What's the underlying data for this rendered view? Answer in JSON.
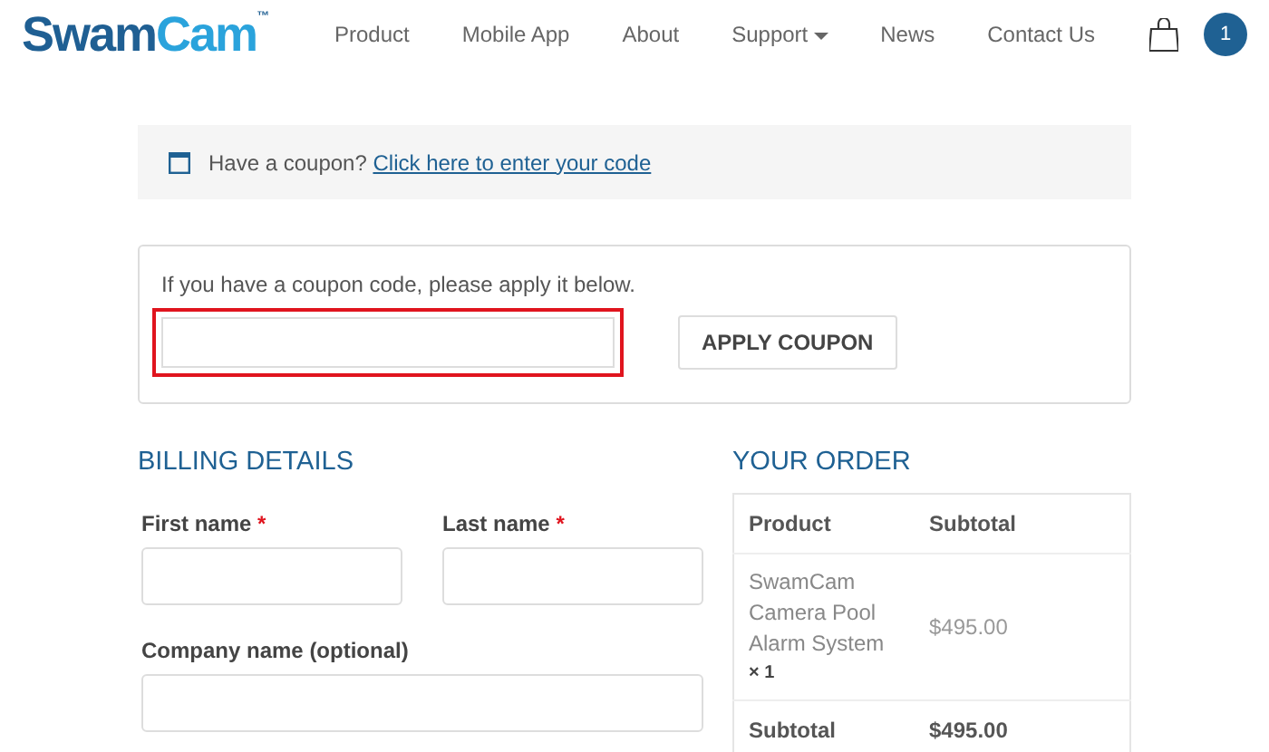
{
  "logo": {
    "first": "Swam",
    "second": "Cam",
    "mark": "™"
  },
  "nav": [
    {
      "label": "Product",
      "dropdown": false
    },
    {
      "label": "Mobile App",
      "dropdown": false
    },
    {
      "label": "About",
      "dropdown": false
    },
    {
      "label": "Support",
      "dropdown": true
    },
    {
      "label": "News",
      "dropdown": false
    },
    {
      "label": "Contact Us",
      "dropdown": false
    }
  ],
  "cart_count": "1",
  "coupon_notice": {
    "text": "Have a coupon?",
    "link": "Click here to enter your code"
  },
  "coupon_form": {
    "hint": "If you have a coupon code, please apply it below.",
    "field_highlighted": true,
    "button": "APPLY COUPON"
  },
  "billing": {
    "title": "BILLING DETAILS",
    "fields": [
      {
        "label": "First name",
        "required_mark": "*",
        "kind": "half"
      },
      {
        "label": "Last name",
        "required_mark": "*",
        "kind": "half"
      },
      {
        "label": "Company name (optional)",
        "kind": "full"
      }
    ]
  },
  "order": {
    "title": "YOUR ORDER",
    "columns": [
      "Product",
      "Subtotal"
    ],
    "rows": [
      {
        "kind": "item",
        "product": "SwamCam Camera Pool Alarm System",
        "quantity": "× 1",
        "subtotal": "$495.00"
      },
      {
        "kind": "total",
        "product": "Subtotal",
        "subtotal": "$495.00"
      }
    ]
  }
}
